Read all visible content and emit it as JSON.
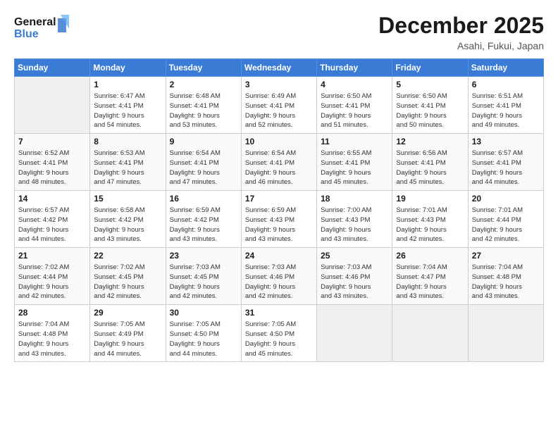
{
  "logo": {
    "line1": "General",
    "line2": "Blue"
  },
  "title": "December 2025",
  "location": "Asahi, Fukui, Japan",
  "header": {
    "days": [
      "Sunday",
      "Monday",
      "Tuesday",
      "Wednesday",
      "Thursday",
      "Friday",
      "Saturday"
    ]
  },
  "weeks": [
    [
      {
        "day": "",
        "info": ""
      },
      {
        "day": "1",
        "info": "Sunrise: 6:47 AM\nSunset: 4:41 PM\nDaylight: 9 hours\nand 54 minutes."
      },
      {
        "day": "2",
        "info": "Sunrise: 6:48 AM\nSunset: 4:41 PM\nDaylight: 9 hours\nand 53 minutes."
      },
      {
        "day": "3",
        "info": "Sunrise: 6:49 AM\nSunset: 4:41 PM\nDaylight: 9 hours\nand 52 minutes."
      },
      {
        "day": "4",
        "info": "Sunrise: 6:50 AM\nSunset: 4:41 PM\nDaylight: 9 hours\nand 51 minutes."
      },
      {
        "day": "5",
        "info": "Sunrise: 6:50 AM\nSunset: 4:41 PM\nDaylight: 9 hours\nand 50 minutes."
      },
      {
        "day": "6",
        "info": "Sunrise: 6:51 AM\nSunset: 4:41 PM\nDaylight: 9 hours\nand 49 minutes."
      }
    ],
    [
      {
        "day": "7",
        "info": "Sunrise: 6:52 AM\nSunset: 4:41 PM\nDaylight: 9 hours\nand 48 minutes."
      },
      {
        "day": "8",
        "info": "Sunrise: 6:53 AM\nSunset: 4:41 PM\nDaylight: 9 hours\nand 47 minutes."
      },
      {
        "day": "9",
        "info": "Sunrise: 6:54 AM\nSunset: 4:41 PM\nDaylight: 9 hours\nand 47 minutes."
      },
      {
        "day": "10",
        "info": "Sunrise: 6:54 AM\nSunset: 4:41 PM\nDaylight: 9 hours\nand 46 minutes."
      },
      {
        "day": "11",
        "info": "Sunrise: 6:55 AM\nSunset: 4:41 PM\nDaylight: 9 hours\nand 45 minutes."
      },
      {
        "day": "12",
        "info": "Sunrise: 6:56 AM\nSunset: 4:41 PM\nDaylight: 9 hours\nand 45 minutes."
      },
      {
        "day": "13",
        "info": "Sunrise: 6:57 AM\nSunset: 4:41 PM\nDaylight: 9 hours\nand 44 minutes."
      }
    ],
    [
      {
        "day": "14",
        "info": "Sunrise: 6:57 AM\nSunset: 4:42 PM\nDaylight: 9 hours\nand 44 minutes."
      },
      {
        "day": "15",
        "info": "Sunrise: 6:58 AM\nSunset: 4:42 PM\nDaylight: 9 hours\nand 43 minutes."
      },
      {
        "day": "16",
        "info": "Sunrise: 6:59 AM\nSunset: 4:42 PM\nDaylight: 9 hours\nand 43 minutes."
      },
      {
        "day": "17",
        "info": "Sunrise: 6:59 AM\nSunset: 4:43 PM\nDaylight: 9 hours\nand 43 minutes."
      },
      {
        "day": "18",
        "info": "Sunrise: 7:00 AM\nSunset: 4:43 PM\nDaylight: 9 hours\nand 43 minutes."
      },
      {
        "day": "19",
        "info": "Sunrise: 7:01 AM\nSunset: 4:43 PM\nDaylight: 9 hours\nand 42 minutes."
      },
      {
        "day": "20",
        "info": "Sunrise: 7:01 AM\nSunset: 4:44 PM\nDaylight: 9 hours\nand 42 minutes."
      }
    ],
    [
      {
        "day": "21",
        "info": "Sunrise: 7:02 AM\nSunset: 4:44 PM\nDaylight: 9 hours\nand 42 minutes."
      },
      {
        "day": "22",
        "info": "Sunrise: 7:02 AM\nSunset: 4:45 PM\nDaylight: 9 hours\nand 42 minutes."
      },
      {
        "day": "23",
        "info": "Sunrise: 7:03 AM\nSunset: 4:45 PM\nDaylight: 9 hours\nand 42 minutes."
      },
      {
        "day": "24",
        "info": "Sunrise: 7:03 AM\nSunset: 4:46 PM\nDaylight: 9 hours\nand 42 minutes."
      },
      {
        "day": "25",
        "info": "Sunrise: 7:03 AM\nSunset: 4:46 PM\nDaylight: 9 hours\nand 43 minutes."
      },
      {
        "day": "26",
        "info": "Sunrise: 7:04 AM\nSunset: 4:47 PM\nDaylight: 9 hours\nand 43 minutes."
      },
      {
        "day": "27",
        "info": "Sunrise: 7:04 AM\nSunset: 4:48 PM\nDaylight: 9 hours\nand 43 minutes."
      }
    ],
    [
      {
        "day": "28",
        "info": "Sunrise: 7:04 AM\nSunset: 4:48 PM\nDaylight: 9 hours\nand 43 minutes."
      },
      {
        "day": "29",
        "info": "Sunrise: 7:05 AM\nSunset: 4:49 PM\nDaylight: 9 hours\nand 44 minutes."
      },
      {
        "day": "30",
        "info": "Sunrise: 7:05 AM\nSunset: 4:50 PM\nDaylight: 9 hours\nand 44 minutes."
      },
      {
        "day": "31",
        "info": "Sunrise: 7:05 AM\nSunset: 4:50 PM\nDaylight: 9 hours\nand 45 minutes."
      },
      {
        "day": "",
        "info": ""
      },
      {
        "day": "",
        "info": ""
      },
      {
        "day": "",
        "info": ""
      }
    ]
  ]
}
